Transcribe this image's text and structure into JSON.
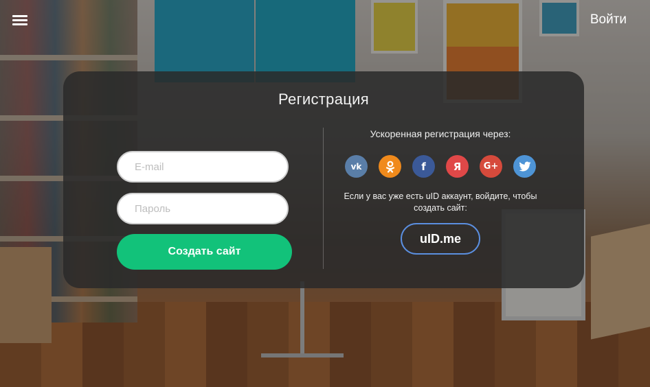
{
  "header": {
    "login_label": "Войти",
    "menu_icon": "hamburger-menu-icon"
  },
  "modal": {
    "title": "Регистрация",
    "email_placeholder": "E-mail",
    "password_placeholder": "Пароль",
    "submit_label": "Создать сайт",
    "fast_title": "Ускоренная регистрация через:",
    "socials": [
      {
        "name": "vk",
        "glyph": "vk",
        "color": "#5a7ea8"
      },
      {
        "name": "odnoklassniki",
        "glyph": "ok",
        "color": "#f08a1c"
      },
      {
        "name": "facebook",
        "glyph": "f",
        "color": "#3b5998"
      },
      {
        "name": "yandex",
        "glyph": "Я",
        "color": "#e04848"
      },
      {
        "name": "google-plus",
        "glyph": "G+",
        "color": "#d64a3c"
      },
      {
        "name": "twitter",
        "glyph": "bird",
        "color": "#4e94d6"
      }
    ],
    "uid_note": "Если у вас уже есть uID аккаунт, войдите, чтобы создать сайт:",
    "uid_button": "uID.me",
    "accent_color": "#12c27a"
  }
}
